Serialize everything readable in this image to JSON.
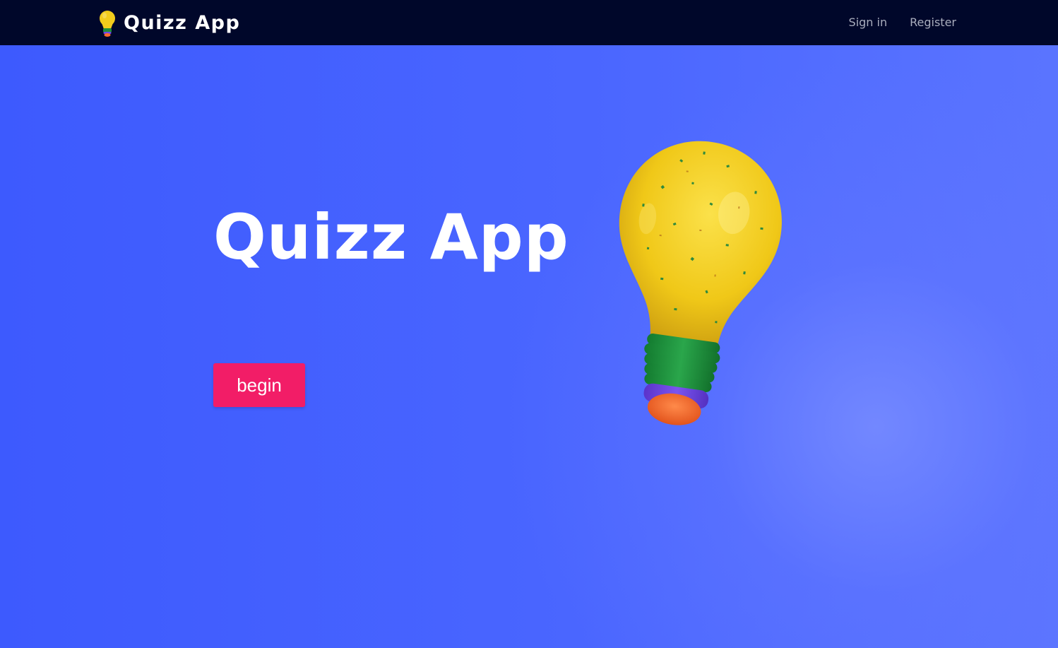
{
  "nav": {
    "brand_title": "Quizz App",
    "brand_icon": "lightbulb-icon",
    "links": [
      "Sign in",
      "Register"
    ]
  },
  "hero": {
    "title": "Quizz App",
    "button_label": "begin",
    "illustration": "lightbulb-illustration"
  },
  "colors": {
    "navbar": "#00072a",
    "background": "#3d5afe",
    "button": "#f21d67",
    "nav_link": "#a9adbd",
    "bulb_yellow": "#f2cc1c",
    "bulb_green": "#1e8f3a",
    "bulb_purple": "#6f48e6",
    "bulb_orange": "#ff6a2c"
  }
}
